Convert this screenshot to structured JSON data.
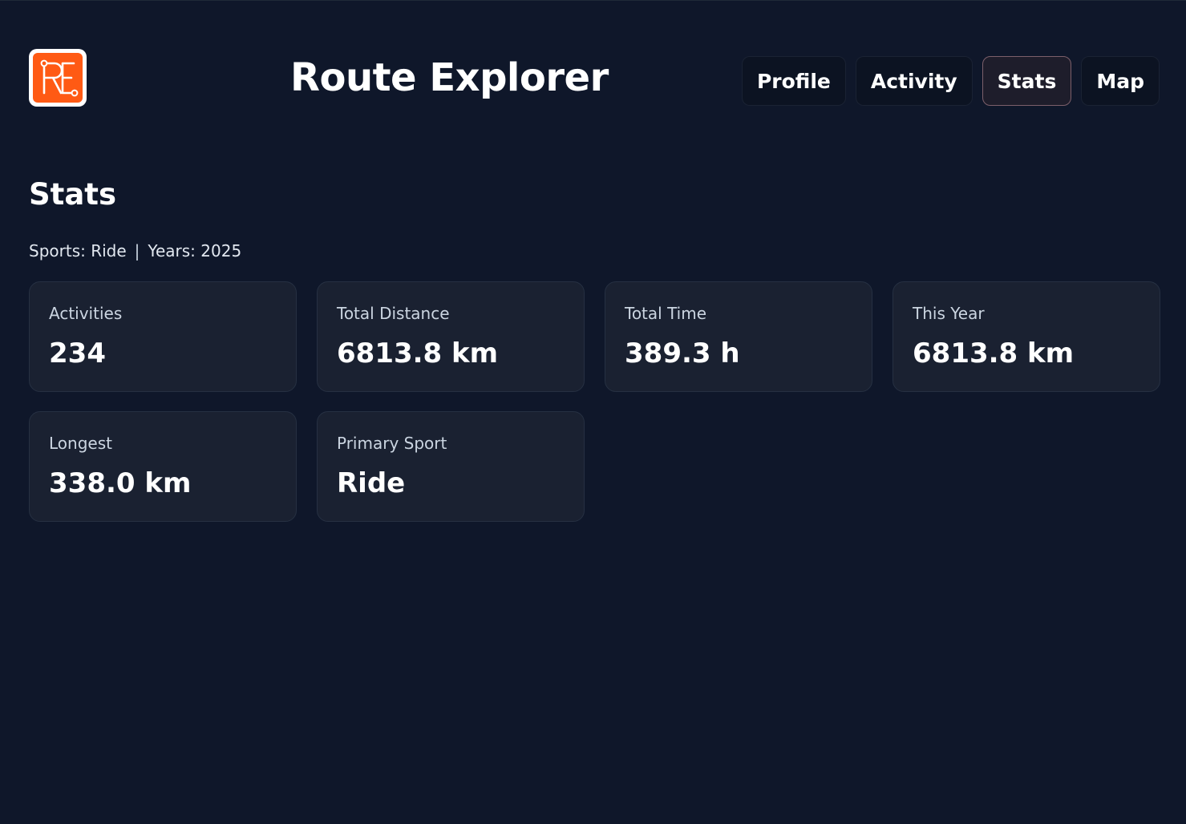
{
  "app": {
    "title": "Route Explorer",
    "logo_icon": "route-explorer-logo-icon",
    "brand_color": "#ff5a14"
  },
  "nav": {
    "items": [
      {
        "label": "Profile",
        "active": false
      },
      {
        "label": "Activity",
        "active": false
      },
      {
        "label": "Stats",
        "active": true
      },
      {
        "label": "Map",
        "active": false
      }
    ]
  },
  "page": {
    "title": "Stats",
    "filters": {
      "sports": "Sports: Ride",
      "separator": "|",
      "years": "Years: 2025"
    }
  },
  "stats": [
    {
      "label": "Activities",
      "value": "234"
    },
    {
      "label": "Total Distance",
      "value": "6813.8 km"
    },
    {
      "label": "Total Time",
      "value": "389.3 h"
    },
    {
      "label": "This Year",
      "value": "6813.8 km"
    },
    {
      "label": "Longest",
      "value": "338.0 km"
    },
    {
      "label": "Primary Sport",
      "value": "Ride"
    }
  ]
}
